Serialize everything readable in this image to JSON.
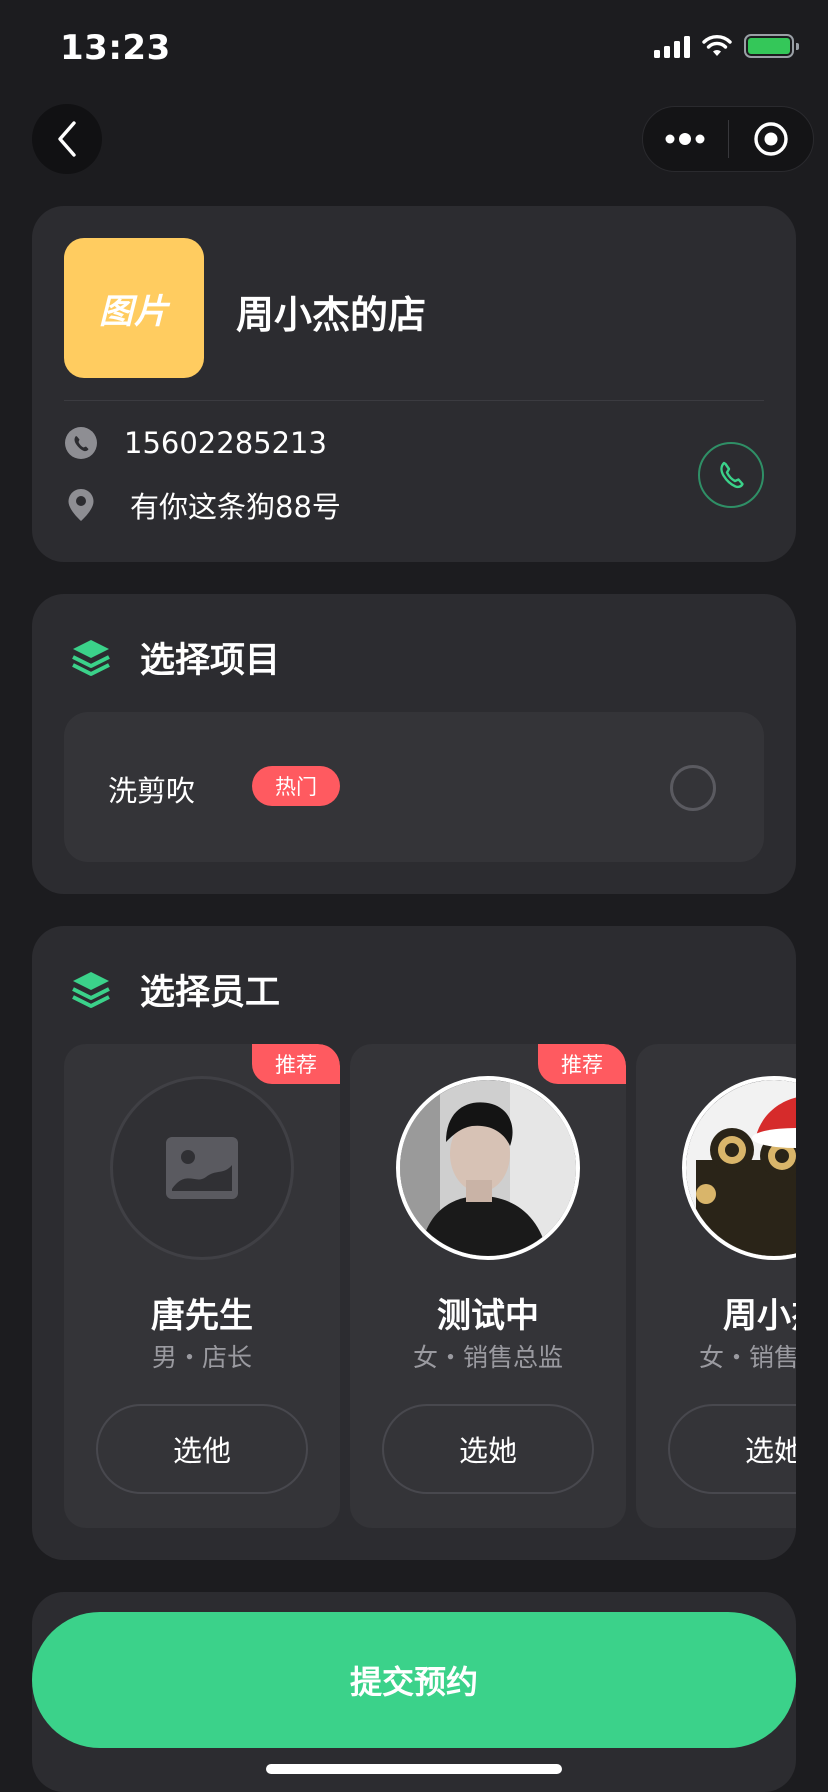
{
  "status_bar": {
    "time": "13:23"
  },
  "shop": {
    "logo_text": "图片",
    "name": "周小杰的店",
    "phone": "15602285213",
    "address": "有你这条狗88号"
  },
  "service_section": {
    "title": "选择项目",
    "items": [
      {
        "name": "洗剪吹",
        "tag": "热门"
      }
    ]
  },
  "staff_section": {
    "title": "选择员工",
    "staff": [
      {
        "name": "唐先生",
        "sub": "男・店长",
        "button": "选他",
        "tag": "推荐"
      },
      {
        "name": "测试中",
        "sub": "女・销售总监",
        "button": "选她",
        "tag": "推荐"
      },
      {
        "name": "周小杰",
        "sub": "女・销售总监",
        "button": "选她",
        "tag": ""
      }
    ]
  },
  "submit": {
    "label": "提交预约"
  },
  "colors": {
    "accent": "#3bd28a",
    "tag": "#ff5a60",
    "logo": "#ffcc60",
    "card": "#2c2c30",
    "background": "#1c1c1f"
  }
}
